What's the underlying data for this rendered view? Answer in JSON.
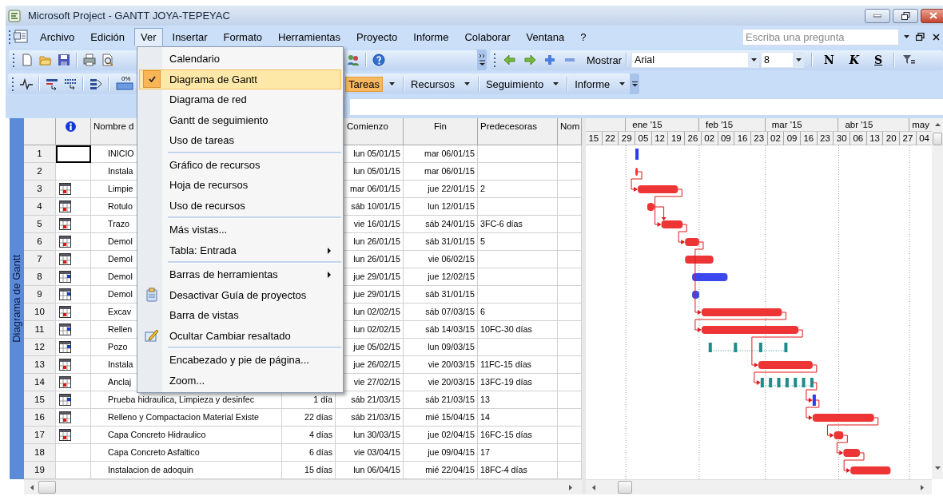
{
  "window": {
    "title": "Microsoft Project - GANTT JOYA-TEPEYAC"
  },
  "menu_bar": {
    "items": [
      {
        "label": "Archivo",
        "selected": false
      },
      {
        "label": "Edición",
        "selected": false
      },
      {
        "label": "Ver",
        "selected": true
      },
      {
        "label": "Insertar",
        "selected": false
      },
      {
        "label": "Formato",
        "selected": false
      },
      {
        "label": "Herramientas",
        "selected": false
      },
      {
        "label": "Proyecto",
        "selected": false
      },
      {
        "label": "Informe",
        "selected": false
      },
      {
        "label": "Colaborar",
        "selected": false
      },
      {
        "label": "Ventana",
        "selected": false
      },
      {
        "label": "?",
        "selected": false
      }
    ],
    "help_search": {
      "placeholder": "Escriba una pregunta"
    }
  },
  "formatting_toolbar": {
    "show_button": {
      "label": "Mostrar"
    },
    "font": {
      "value": "Arial"
    },
    "font_size": {
      "value": "8"
    },
    "style_buttons": [
      {
        "label": "N",
        "kind": "bold"
      },
      {
        "label": "K",
        "kind": "italic"
      },
      {
        "label": "S",
        "kind": "underline"
      }
    ]
  },
  "guide_toolbar": {
    "progress_icon_text": "0%",
    "buttons": [
      {
        "label": "Tareas",
        "selected": true
      },
      {
        "label": "Recursos",
        "selected": false
      },
      {
        "label": "Seguimiento",
        "selected": false
      },
      {
        "label": "Informe",
        "selected": false
      }
    ]
  },
  "view_bar": {
    "label": "Diagrama de Gantt"
  },
  "table": {
    "columns": [
      "Nombre d",
      "Comienzo",
      "Fin",
      "Predecesoras",
      "Nom"
    ],
    "rows": [
      {
        "id": "1",
        "selected": true,
        "name": "INICIO",
        "start": "lun 05/01/15",
        "finish": "mar 06/01/15",
        "bar": {
          "kind": "marker",
          "color": "#2a3af0"
        }
      },
      {
        "id": "2",
        "selected": false,
        "name": "Instala",
        "start": "lun 05/01/15",
        "finish": "mar 06/01/15",
        "bar": {
          "kind": "task",
          "color": "#ee3535"
        }
      },
      {
        "id": "3",
        "selected": false,
        "indicator": {
          "kind": "constraint"
        },
        "name": "Limpie",
        "start": "mar 06/01/15",
        "finish": "jue 22/01/15",
        "predecessors": "2",
        "bar": {
          "kind": "task",
          "color": "#ee3535"
        }
      },
      {
        "id": "4",
        "selected": false,
        "indicator": {
          "kind": "constraint"
        },
        "name": "Rotulo",
        "start": "sáb 10/01/15",
        "finish": "lun 12/01/15",
        "bar": {
          "kind": "task",
          "color": "#ee3535"
        }
      },
      {
        "id": "5",
        "selected": false,
        "indicator": {
          "kind": "constraint"
        },
        "name": "Trazo",
        "start": "vie 16/01/15",
        "finish": "sáb 24/01/15",
        "predecessors": "3FC-6 días",
        "bar": {
          "kind": "task",
          "color": "#ee3535"
        }
      },
      {
        "id": "6",
        "selected": false,
        "indicator": {
          "kind": "constraint"
        },
        "name": "Demol",
        "start": "lun 26/01/15",
        "finish": "sáb 31/01/15",
        "predecessors": "5",
        "bar": {
          "kind": "task",
          "color": "#ee3535"
        }
      },
      {
        "id": "7",
        "selected": false,
        "indicator": {
          "kind": "constraint"
        },
        "name": "Demol",
        "start": "lun 26/01/15",
        "finish": "vie 06/02/15",
        "bar": {
          "kind": "task",
          "color": "#ee3535"
        }
      },
      {
        "id": "8",
        "selected": false,
        "indicator": {
          "kind": "calendar"
        },
        "name": "Demol",
        "start": "jue 29/01/15",
        "finish": "jue 12/02/15",
        "bar": {
          "kind": "task",
          "color": "#3a48ee"
        }
      },
      {
        "id": "9",
        "selected": false,
        "indicator": {
          "kind": "calendar"
        },
        "name": "Demol",
        "start": "jue 29/01/15",
        "finish": "sáb 31/01/15",
        "bar": {
          "kind": "task",
          "color": "#3a48ee"
        }
      },
      {
        "id": "10",
        "selected": false,
        "indicator": {
          "kind": "constraint"
        },
        "name": "Excav",
        "start": "lun 02/02/15",
        "finish": "sáb 07/03/15",
        "predecessors": "6",
        "bar": {
          "kind": "task",
          "color": "#ee3535"
        }
      },
      {
        "id": "11",
        "selected": false,
        "indicator": {
          "kind": "calendar"
        },
        "name": "Rellen",
        "start": "lun 02/02/15",
        "finish": "sáb 14/03/15",
        "predecessors": "10FC-30 días",
        "bar": {
          "kind": "task",
          "color": "#ee3535"
        }
      },
      {
        "id": "12",
        "selected": false,
        "indicator": {
          "kind": "calendar"
        },
        "name": "Pozo",
        "start": "jue 05/02/15",
        "finish": "lun 09/03/15",
        "bar": {
          "kind": "split",
          "color": "#1f8c8c"
        }
      },
      {
        "id": "13",
        "selected": false,
        "indicator": {
          "kind": "constraint"
        },
        "name": "Instala",
        "start": "jue 26/02/15",
        "finish": "vie 20/03/15",
        "predecessors": "11FC-15 días",
        "bar": {
          "kind": "task",
          "color": "#ee3535"
        }
      },
      {
        "id": "14",
        "selected": false,
        "indicator": {
          "kind": "constraint"
        },
        "name": "Anclaj",
        "start": "vie 27/02/15",
        "finish": "vie 20/03/15",
        "predecessors": "13FC-19 días",
        "bar": {
          "kind": "split",
          "color": "#1f8c8c"
        }
      },
      {
        "id": "15",
        "selected": false,
        "indicator": {
          "kind": "calendar"
        },
        "name": "Prueba hidraulica, Limpieza y desinfec",
        "duration": "1 día",
        "start": "sáb 21/03/15",
        "finish": "sáb 21/03/15",
        "predecessors": "13",
        "bar": {
          "kind": "marker",
          "color": "#2a3af0"
        }
      },
      {
        "id": "16",
        "selected": false,
        "indicator": {
          "kind": "constraint"
        },
        "name": "Relleno y Compactacion Material Existe",
        "duration": "22 días",
        "start": "sáb 21/03/15",
        "finish": "mié 15/04/15",
        "predecessors": "14",
        "bar": {
          "kind": "task",
          "color": "#ee3535"
        }
      },
      {
        "id": "17",
        "selected": false,
        "indicator": {
          "kind": "constraint"
        },
        "name": "Capa Concreto Hidraulico",
        "duration": "4 días",
        "start": "lun 30/03/15",
        "finish": "jue 02/04/15",
        "predecessors": "16FC-15 días",
        "bar": {
          "kind": "task",
          "color": "#ee3535"
        }
      },
      {
        "id": "18",
        "selected": false,
        "name": "Capa Concreto Asfaltico",
        "duration": "6 días",
        "start": "vie 03/04/15",
        "finish": "jue 09/04/15",
        "predecessors": "17",
        "bar": {
          "kind": "task",
          "color": "#ee3535"
        }
      },
      {
        "id": "19",
        "selected": false,
        "name": "Instalacion de adoquin",
        "duration": "15 días",
        "start": "lun 06/04/15",
        "finish": "mié 22/04/15",
        "predecessors": "18FC-4 días",
        "bar": {
          "kind": "task",
          "color": "#ee3535"
        }
      }
    ]
  },
  "gantt": {
    "months": [
      "ene '15",
      "feb '15",
      "mar '15",
      "abr '15",
      "may"
    ],
    "weeks": [
      "15",
      "22",
      "29",
      "05",
      "12",
      "19",
      "26",
      "02",
      "09",
      "16",
      "23",
      "02",
      "09",
      "16",
      "23",
      "30",
      "06",
      "13",
      "20",
      "27",
      "04"
    ]
  },
  "view_menu": {
    "groups": [
      [
        {
          "label": "Calendario",
          "kind": "plain",
          "checked": false,
          "selected": false
        },
        {
          "label": "Diagrama de Gantt",
          "kind": "plain",
          "checked": true,
          "selected": true
        },
        {
          "label": "Diagrama de red",
          "kind": "plain",
          "checked": false,
          "selected": false
        },
        {
          "label": "Gantt de seguimiento",
          "kind": "plain",
          "checked": false,
          "selected": false
        },
        {
          "label": "Uso de tareas",
          "kind": "plain",
          "checked": false,
          "selected": false
        }
      ],
      [
        {
          "label": "Gráfico de recursos",
          "kind": "plain",
          "checked": false,
          "selected": false
        },
        {
          "label": "Hoja de recursos",
          "kind": "plain",
          "checked": false,
          "selected": false
        },
        {
          "label": "Uso de recursos",
          "kind": "plain",
          "checked": false,
          "selected": false
        }
      ],
      [
        {
          "label": "Más vistas...",
          "kind": "plain",
          "checked": false,
          "selected": false
        },
        {
          "label": "Tabla: Entrada",
          "kind": "submenu",
          "checked": false,
          "selected": false
        }
      ],
      [
        {
          "label": "Barras de herramientas",
          "kind": "submenu",
          "checked": false,
          "selected": false
        },
        {
          "label": "Desactivar Guía de proyectos",
          "kind": "guide-toggle",
          "checked": false,
          "selected": false
        },
        {
          "label": "Barra de vistas",
          "kind": "plain",
          "checked": false,
          "selected": false
        },
        {
          "label": "Ocultar Cambiar resaltado",
          "kind": "highlight-toggle",
          "checked": false,
          "selected": false
        }
      ],
      [
        {
          "label": "Encabezado y pie de página...",
          "kind": "plain",
          "checked": false,
          "selected": false
        },
        {
          "label": "Zoom...",
          "kind": "plain",
          "checked": false,
          "selected": false
        }
      ]
    ]
  }
}
